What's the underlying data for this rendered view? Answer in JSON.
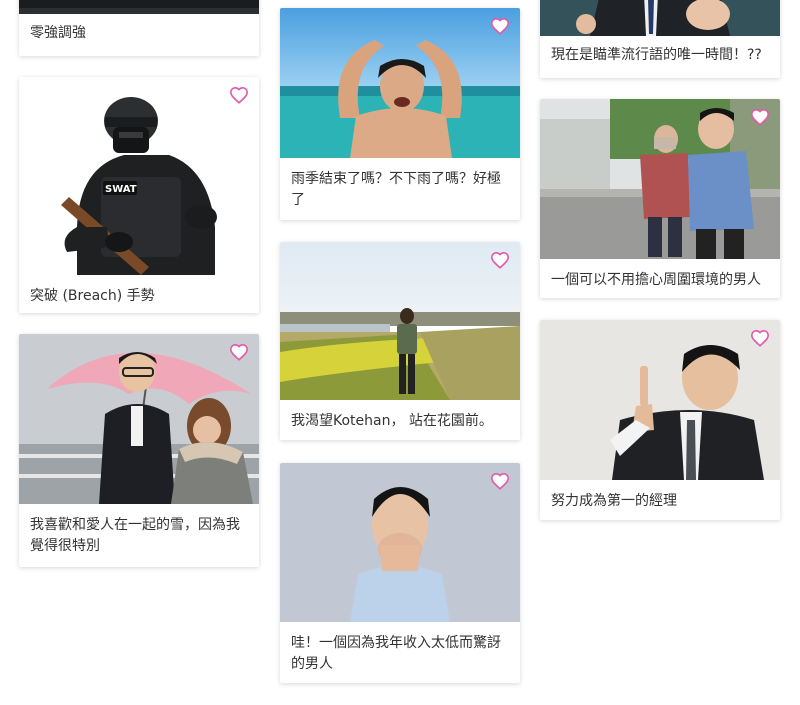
{
  "cards": [
    {
      "caption": "零強調強",
      "favorite_icon": "heart-icon"
    },
    {
      "caption": "突破 (Breach) 手勢",
      "favorite_icon": "heart-icon"
    },
    {
      "caption": "我喜歡和愛人在一起的雪，因為我覺得很特別",
      "favorite_icon": "heart-icon"
    },
    {
      "caption": "雨季結束了嗎？不下雨了嗎？好極了",
      "favorite_icon": "heart-icon"
    },
    {
      "caption": "我渴望Kotehan， 站在花園前。",
      "favorite_icon": "heart-icon"
    },
    {
      "caption": "哇！一個因為我年收入太低而驚訝的男人",
      "favorite_icon": "heart-icon"
    },
    {
      "caption": "現在是瞄準流行語的唯一時間！??",
      "favorite_icon": "heart-icon"
    },
    {
      "caption": "一個可以不用擔心周圍環境的男人",
      "favorite_icon": "heart-icon"
    },
    {
      "caption": "努力成為第一的經理",
      "favorite_icon": "heart-icon"
    }
  ],
  "colors": {
    "heart": "#e25aa8",
    "card_shadow": "#d0d0d0",
    "text": "#333333"
  }
}
